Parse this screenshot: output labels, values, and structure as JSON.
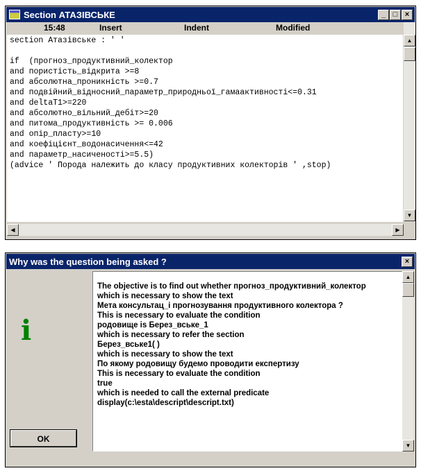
{
  "editor": {
    "title": "Section АТАЗІВСЬКЕ",
    "status": {
      "time": "15:48",
      "insert": "Insert",
      "indent": "Indent",
      "modified": "Modified"
    },
    "lines": [
      "section Атазівське : ' '",
      "",
      "if  (прогноз_продуктивний_колектор",
      "and пористість_відкрита >=8",
      "and абсолютна_проникність >=0.7",
      "and подвійний_відносний_параметр_природньої_гамаактивності<=0.31",
      "and deltaT1>=220",
      "and абсолютно_вільний_дебіт>=20",
      "and питома_продуктивність >= 0.006",
      "and опір_пласту>=10",
      "and коефіцієнт_водонасичення<=42",
      "and параметр_насиченості>=5.5)",
      "(advice ' Порода належить до класу продуктивних колекторів ' ,stop)"
    ]
  },
  "dialog": {
    "title": "Why was the question being asked ?",
    "close_label": "×",
    "ok_label": "OK",
    "lines": [
      "The objective is to find out whether прогноз_продуктивний_колектор",
      "which is necessary to show the text",
      "Мета консультац_і прогнозування продуктивного колектора ?",
      "This is necessary to evaluate the condition",
      "родовище is Берез_вське_1",
      "which is necessary to refer the section",
      "Берез_вське1( )",
      "which is necessary to show the text",
      "По якому родовищу будемо проводити експертизу",
      "This is necessary to evaluate the condition",
      " true",
      "which is needed to call the external predicate",
      "display(c:\\esta\\descript\\descript.txt)"
    ]
  },
  "icons": {
    "minimize": "minimize-icon",
    "maximize": "maximize-icon",
    "close": "close-icon",
    "info": "info-icon"
  },
  "colors": {
    "titlebar": "#0a246a",
    "face": "#d4d0c8",
    "info_icon": "#008000"
  }
}
